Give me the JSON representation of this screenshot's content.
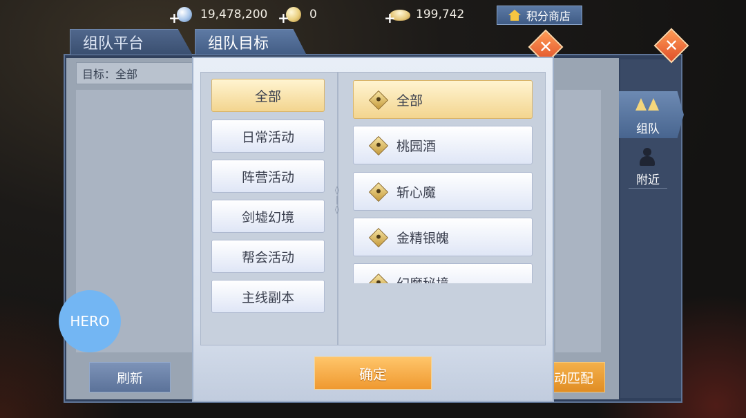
{
  "currency": {
    "silver": "19,478,200",
    "gold": "0",
    "ingot": "199,742"
  },
  "shop_button": "积分商店",
  "tabs": [
    "组队平台",
    "组队目标"
  ],
  "goal_field": "目标：全部",
  "refresh_button": "刷新",
  "auto_match_button": "动匹配",
  "side_nav": {
    "team": "组队",
    "nearby": "附近"
  },
  "dialog": {
    "categories": [
      "全部",
      "日常活动",
      "阵营活动",
      "剑墟幻境",
      "帮会活动",
      "主线副本"
    ],
    "selected_category": "全部",
    "sub_items": [
      "全部",
      "桃园酒",
      "斩心魔",
      "金精银魄",
      "幻魔秘境"
    ],
    "selected_sub_item": "全部",
    "confirm_button": "确定"
  },
  "hero_badge": "HERO",
  "icons": {
    "close": "close-icon",
    "shop": "house-icon",
    "team": "flag-icon",
    "nearby": "person-icon"
  }
}
